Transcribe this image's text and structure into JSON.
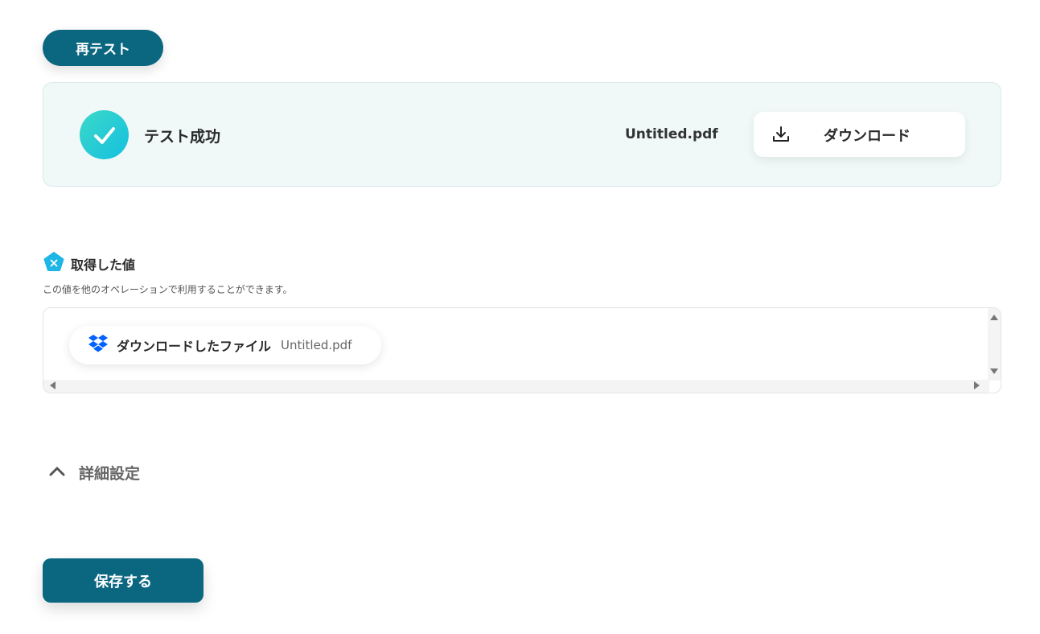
{
  "retest": {
    "label": "再テスト"
  },
  "result": {
    "status": "テスト成功",
    "file_name": "Untitled.pdf",
    "download_label": "ダウンロード",
    "icons": {
      "status": "check-icon",
      "download": "download-icon"
    },
    "colors": {
      "success_start": "#3cd8c8",
      "success_end": "#14c0e0",
      "card_bg": "#f1f9f8"
    }
  },
  "values": {
    "title": "取得した値",
    "description": "この値を他のオペレーションで利用することができます。",
    "icon": "variable-icon",
    "items": [
      {
        "label": "ダウンロードしたファイル",
        "value": "Untitled.pdf",
        "icon": "dropbox-icon"
      }
    ]
  },
  "advanced": {
    "label": "詳細設定",
    "icon": "chevron-up-icon"
  },
  "save": {
    "label": "保存する"
  },
  "colors": {
    "primary": "#0b6680",
    "dropbox": "#0061fe",
    "variable": "#1fb6e6"
  }
}
